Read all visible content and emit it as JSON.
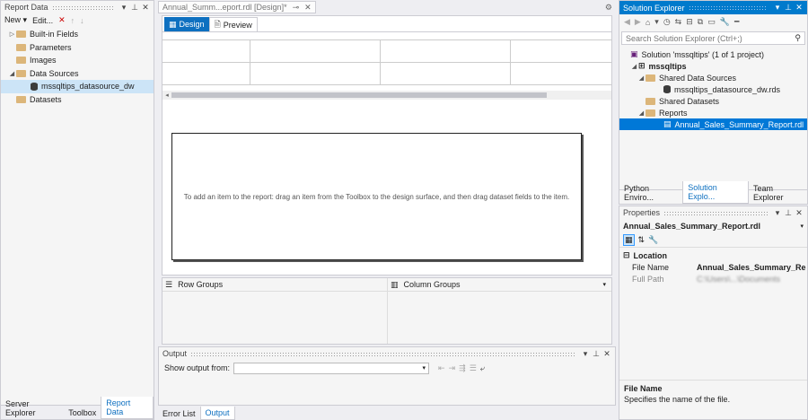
{
  "report_data": {
    "title": "Report Data",
    "toolbar": {
      "new_label": "New",
      "edit_label": "Edit..."
    },
    "tree": [
      {
        "label": "Built-in Fields",
        "expand": "▷",
        "level": 0
      },
      {
        "label": "Parameters",
        "expand": "",
        "level": 0
      },
      {
        "label": "Images",
        "expand": "",
        "level": 0
      },
      {
        "label": "Data Sources",
        "expand": "◢",
        "level": 0
      },
      {
        "label": "mssqltips_datasource_dw",
        "expand": "",
        "level": 1
      },
      {
        "label": "Datasets",
        "expand": "",
        "level": 0
      }
    ],
    "bottom_tabs": [
      "Server Explorer",
      "Toolbox",
      "Report Data"
    ]
  },
  "designer": {
    "doc_tab": "Annual_Summ...eport.rdl [Design]*",
    "tabs": [
      "Design",
      "Preview"
    ],
    "body_hint": "To add an item to the report: drag an item from the Toolbox to the design surface, and then drag dataset fields to the item.",
    "row_groups_label": "Row Groups",
    "column_groups_label": "Column Groups"
  },
  "output": {
    "title": "Output",
    "show_output_label": "Show output from:",
    "show_output_value": "",
    "bottom_tabs": [
      "Error List",
      "Output"
    ]
  },
  "solution_explorer": {
    "title": "Solution Explorer",
    "search_placeholder": "Search Solution Explorer (Ctrl+;)",
    "tree": [
      {
        "label": "Solution 'mssqltips' (1 of 1 project)",
        "expand": "",
        "level": 0
      },
      {
        "label": "mssqltips",
        "expand": "◢",
        "level": 0
      },
      {
        "label": "Shared Data Sources",
        "expand": "◢",
        "level": 1
      },
      {
        "label": "mssqltips_datasource_dw.rds",
        "expand": "",
        "level": 2
      },
      {
        "label": "Shared Datasets",
        "expand": "",
        "level": 1
      },
      {
        "label": "Reports",
        "expand": "◢",
        "level": 1
      },
      {
        "label": "Annual_Sales_Summary_Report.rdl",
        "expand": "",
        "level": 2
      }
    ],
    "bottom_tabs": [
      "Python Enviro...",
      "Solution Explo...",
      "Team Explorer"
    ]
  },
  "properties": {
    "title": "Properties",
    "object_name": "Annual_Sales_Summary_Report.rdl",
    "category": "Location",
    "rows": [
      {
        "name": "File Name",
        "value": "Annual_Sales_Summary_Re"
      },
      {
        "name": "Full Path",
        "value": "C:\\Users\\...\\Documents"
      }
    ],
    "desc_title": "File Name",
    "desc_text": "Specifies the name of the file."
  },
  "colors": {
    "accent": "#007acc",
    "selected": "#0078d7"
  }
}
